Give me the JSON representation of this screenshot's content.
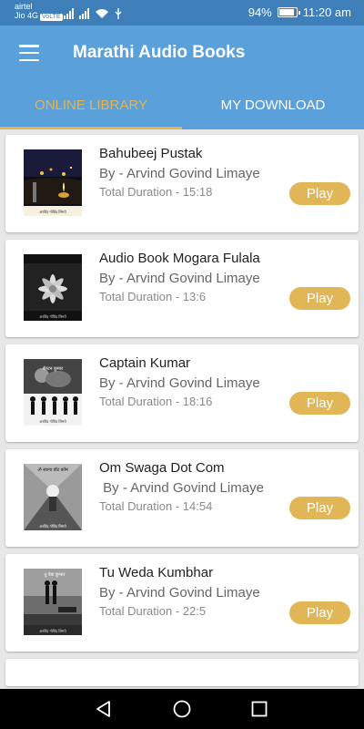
{
  "status_bar": {
    "carrier": "airtel",
    "network": "Jio 4G",
    "volte": "VoLTE",
    "battery_percent": "94%",
    "battery_level": 0.94,
    "time": "11:20 am"
  },
  "app_bar": {
    "title": "Marathi Audio Books",
    "menu_icon": "hamburger-menu-icon"
  },
  "tabs": [
    {
      "label": "ONLINE LIBRARY",
      "active": true
    },
    {
      "label": "MY DOWNLOAD",
      "active": false
    }
  ],
  "books": [
    {
      "title": "Bahubeej Pustak",
      "author": "By - Arvind Govind Limaye",
      "duration": "Total Duration - 15:18",
      "play_label": "Play"
    },
    {
      "title": "Audio Book Mogara Fulala",
      "author": "By - Arvind Govind Limaye",
      "duration": "Total Duration - 13:6",
      "play_label": "Play"
    },
    {
      "title": "Captain Kumar",
      "author": "By - Arvind Govind Limaye",
      "duration": "Total Duration - 18:16",
      "play_label": "Play"
    },
    {
      "title": "Om Swaga Dot Com",
      "author": " By - Arvind Govind Limaye",
      "duration": "Total Duration - 14:54",
      "play_label": "Play"
    },
    {
      "title": "Tu Weda Kumbhar",
      "author": "By - Arvind Govind Limaye",
      "duration": "Total Duration - 22:5",
      "play_label": "Play"
    }
  ],
  "colors": {
    "status_bar": "#3e7fb9",
    "app_bar": "#5aa0da",
    "accent": "#e2b454",
    "play_button": "#e1b657"
  },
  "nav_bar": {
    "back_icon": "back-triangle-icon",
    "home_icon": "home-circle-icon",
    "recent_icon": "recent-apps-square-icon"
  }
}
